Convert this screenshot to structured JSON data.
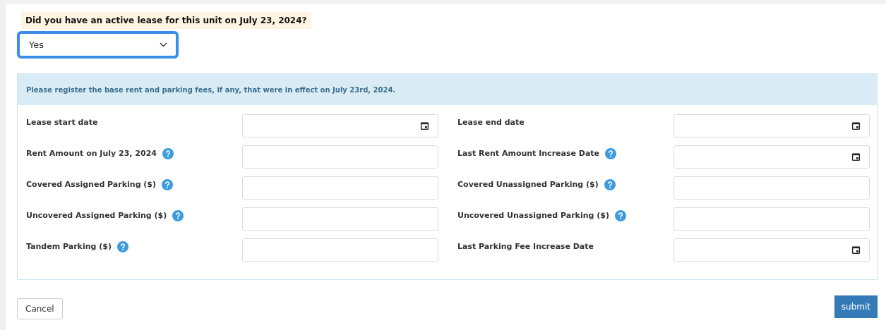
{
  "question": {
    "label": "Did you have an active lease for this unit on July 23, 2024?",
    "answer": "Yes",
    "focused": true
  },
  "panel": {
    "notice": "Please register the base rent and parking fees, if any, that were in effect on July 23rd, 2024.",
    "rows": [
      [
        {
          "label": "Lease start date",
          "kind": "date",
          "help": false
        },
        {
          "label": "Lease end date",
          "kind": "date",
          "help": false
        }
      ],
      [
        {
          "label": "Rent Amount on July 23, 2024",
          "kind": "text",
          "help": true
        },
        {
          "label": "Last Rent Amount Increase Date",
          "kind": "date",
          "help": true
        }
      ],
      [
        {
          "label": "Covered Assigned Parking ($)",
          "kind": "text",
          "help": true
        },
        {
          "label": "Covered Unassigned Parking ($)",
          "kind": "text",
          "help": true
        }
      ],
      [
        {
          "label": "Uncovered Assigned Parking ($)",
          "kind": "text",
          "help": true
        },
        {
          "label": "Uncovered Unassigned Parking ($)",
          "kind": "text",
          "help": true
        }
      ],
      [
        {
          "label": "Tandem Parking ($)",
          "kind": "text",
          "help": true
        },
        {
          "label": "Last Parking Fee Increase Date",
          "kind": "date",
          "help": false
        }
      ]
    ]
  },
  "buttons": {
    "cancel": "Cancel",
    "submit": "submit"
  }
}
